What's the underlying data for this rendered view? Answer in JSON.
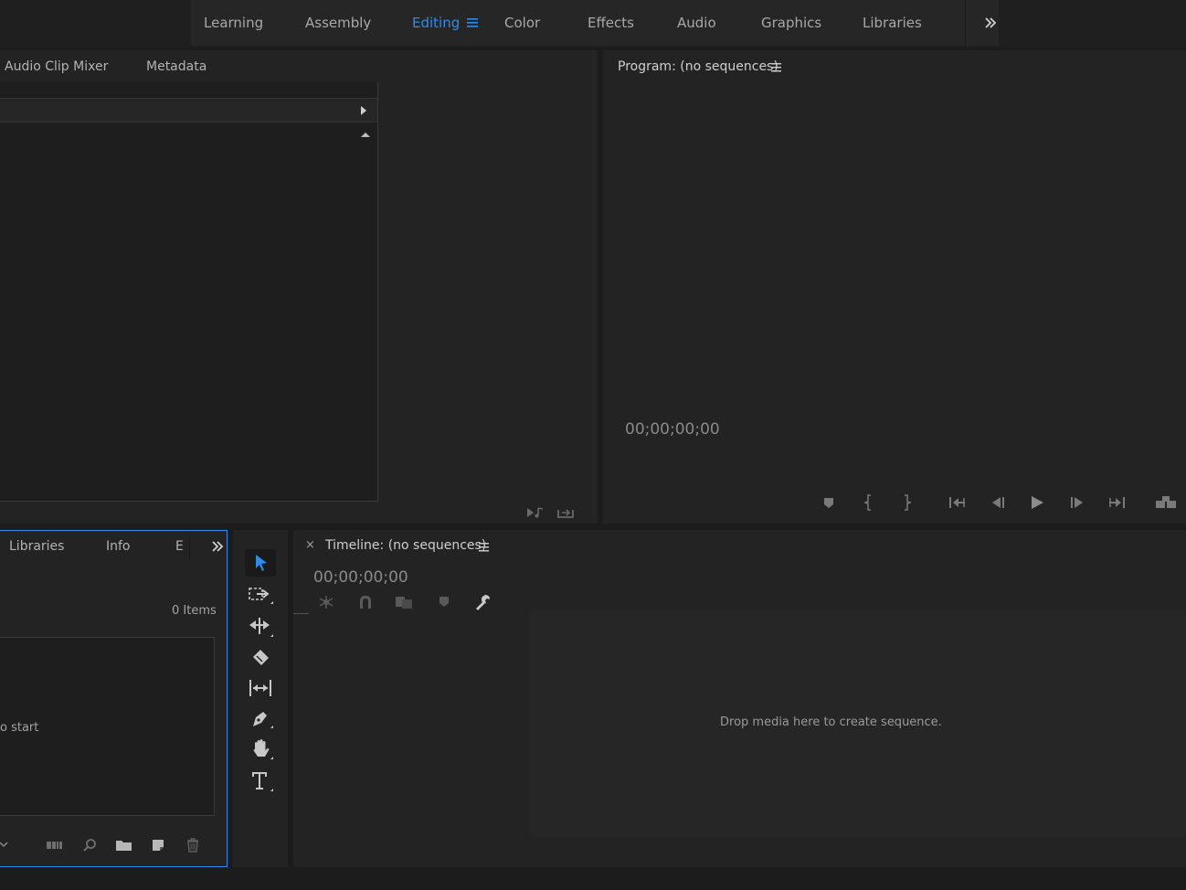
{
  "workspaces": {
    "tabs": [
      {
        "label": "Learning"
      },
      {
        "label": "Assembly"
      },
      {
        "label": "Editing"
      },
      {
        "label": "Color"
      },
      {
        "label": "Effects"
      },
      {
        "label": "Audio"
      },
      {
        "label": "Graphics"
      },
      {
        "label": "Libraries"
      }
    ],
    "active": "Editing",
    "overflow_icon": "double-chevron-right-icon"
  },
  "source_panel": {
    "tabs": [
      {
        "label": "Audio Clip Mixer"
      },
      {
        "label": "Metadata"
      }
    ]
  },
  "program_monitor": {
    "title": "Program: (no sequences)",
    "timecode": "00;00;00;00",
    "controls": [
      "add-marker-icon",
      "mark-in-icon",
      "mark-out-icon",
      "go-to-in-icon",
      "step-back-icon",
      "play-icon",
      "step-forward-icon",
      "go-to-out-icon",
      "button-editor-icon"
    ]
  },
  "project_panel": {
    "tabs": [
      {
        "label": "Libraries"
      },
      {
        "label": "Info"
      },
      {
        "label": "E"
      }
    ],
    "item_count": "0 Items",
    "partial_hint": "o start"
  },
  "tools": [
    "selection-tool-icon",
    "track-select-tool-icon",
    "ripple-edit-tool-icon",
    "razor-tool-icon",
    "slip-tool-icon",
    "pen-tool-icon",
    "hand-tool-icon",
    "type-tool-icon"
  ],
  "timeline": {
    "title": "Timeline: (no sequences)",
    "close_label": "×",
    "timecode": "00;00;00;00",
    "empty_message": "Drop media here to create sequence."
  },
  "colors": {
    "accent": "#2d8ceb",
    "panel_bg": "#232323",
    "app_bg": "#1c1c1c"
  }
}
